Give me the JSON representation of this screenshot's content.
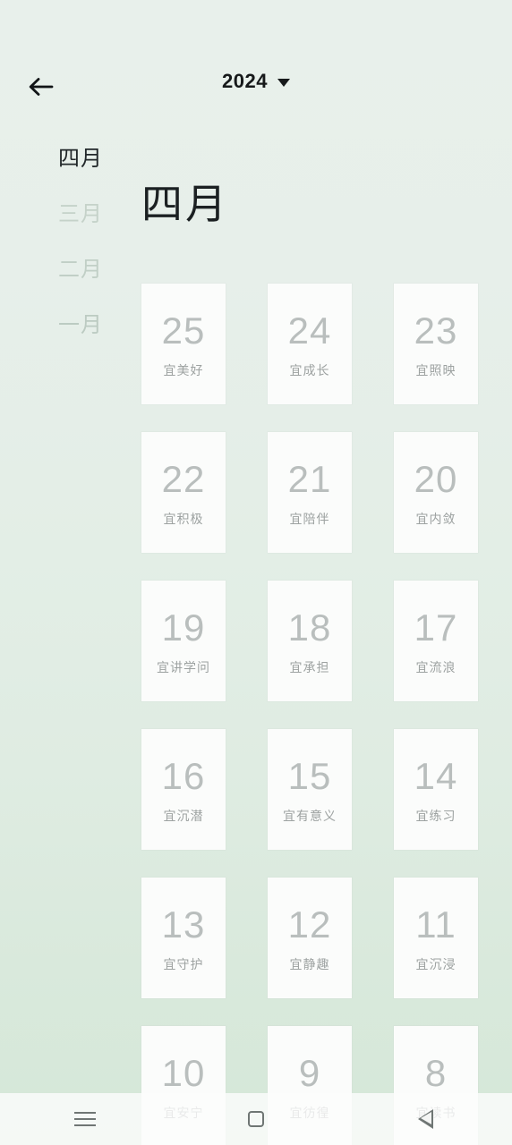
{
  "topbar": {
    "back_icon": "arrow-left-icon",
    "year": "2024",
    "dropdown_icon": "caret-down-icon"
  },
  "month_rail": {
    "items": [
      {
        "label": "四月",
        "active": true
      },
      {
        "label": "三月",
        "active": false
      },
      {
        "label": "二月",
        "active": false
      },
      {
        "label": "一月",
        "active": false
      }
    ]
  },
  "heading": {
    "month": "四月"
  },
  "grid": {
    "days": [
      {
        "num": "25",
        "label": "宜美好"
      },
      {
        "num": "24",
        "label": "宜成长"
      },
      {
        "num": "23",
        "label": "宜照映"
      },
      {
        "num": "22",
        "label": "宜积极"
      },
      {
        "num": "21",
        "label": "宜陪伴"
      },
      {
        "num": "20",
        "label": "宜内敛"
      },
      {
        "num": "19",
        "label": "宜讲学问"
      },
      {
        "num": "18",
        "label": "宜承担"
      },
      {
        "num": "17",
        "label": "宜流浪"
      },
      {
        "num": "16",
        "label": "宜沉潜"
      },
      {
        "num": "15",
        "label": "宜有意义"
      },
      {
        "num": "14",
        "label": "宜练习"
      },
      {
        "num": "13",
        "label": "宜守护"
      },
      {
        "num": "12",
        "label": "宜静趣"
      },
      {
        "num": "11",
        "label": "宜沉浸"
      },
      {
        "num": "10",
        "label": "宜安宁"
      },
      {
        "num": "9",
        "label": "宜彷徨"
      },
      {
        "num": "8",
        "label": "宜读书"
      }
    ]
  },
  "navbar": {
    "recents_icon": "menu-icon",
    "home_icon": "square-icon",
    "back_icon": "triangle-back-icon"
  },
  "colors": {
    "background_top": "#e8f0eb",
    "background_bottom": "#d5e8d8",
    "card_fill": "#fbfcfb",
    "day_number": "#b9bebd",
    "day_label": "#9da2a1",
    "active_month": "#22282a",
    "inactive_month": "#c3d0c7",
    "heading": "#1b2022",
    "topbar_text": "#16191a",
    "nav_icon": "#6f7674"
  }
}
